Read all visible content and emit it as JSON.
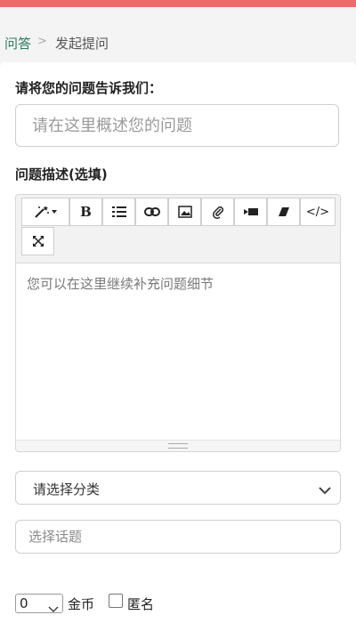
{
  "breadcrumb": {
    "home": "问答",
    "separator": ">",
    "current": "发起提问"
  },
  "form": {
    "title_label": "请将您的问题告诉我们：",
    "title_placeholder": "请在这里概述您的问题",
    "desc_label": "问题描述(选填)",
    "editor_placeholder": "您可以在这里继续补充问题细节",
    "category_value": "请选择分类",
    "topic_placeholder": "选择话题",
    "reward_value": "0",
    "reward_unit": "金币",
    "anonymous_label": "匿名",
    "anonymous_checked": false
  },
  "toolbar": {
    "buttons": [
      "magic-wand-icon",
      "bold-icon",
      "ordered-list-icon",
      "link-icon",
      "image-icon",
      "attachment-icon",
      "video-icon",
      "eraser-icon",
      "code-icon",
      "fullscreen-icon"
    ],
    "bold_glyph": "B",
    "code_glyph": "</>"
  },
  "colors": {
    "accent_bar": "#ef6b6b",
    "breadcrumb_link": "#2c7a5e"
  }
}
